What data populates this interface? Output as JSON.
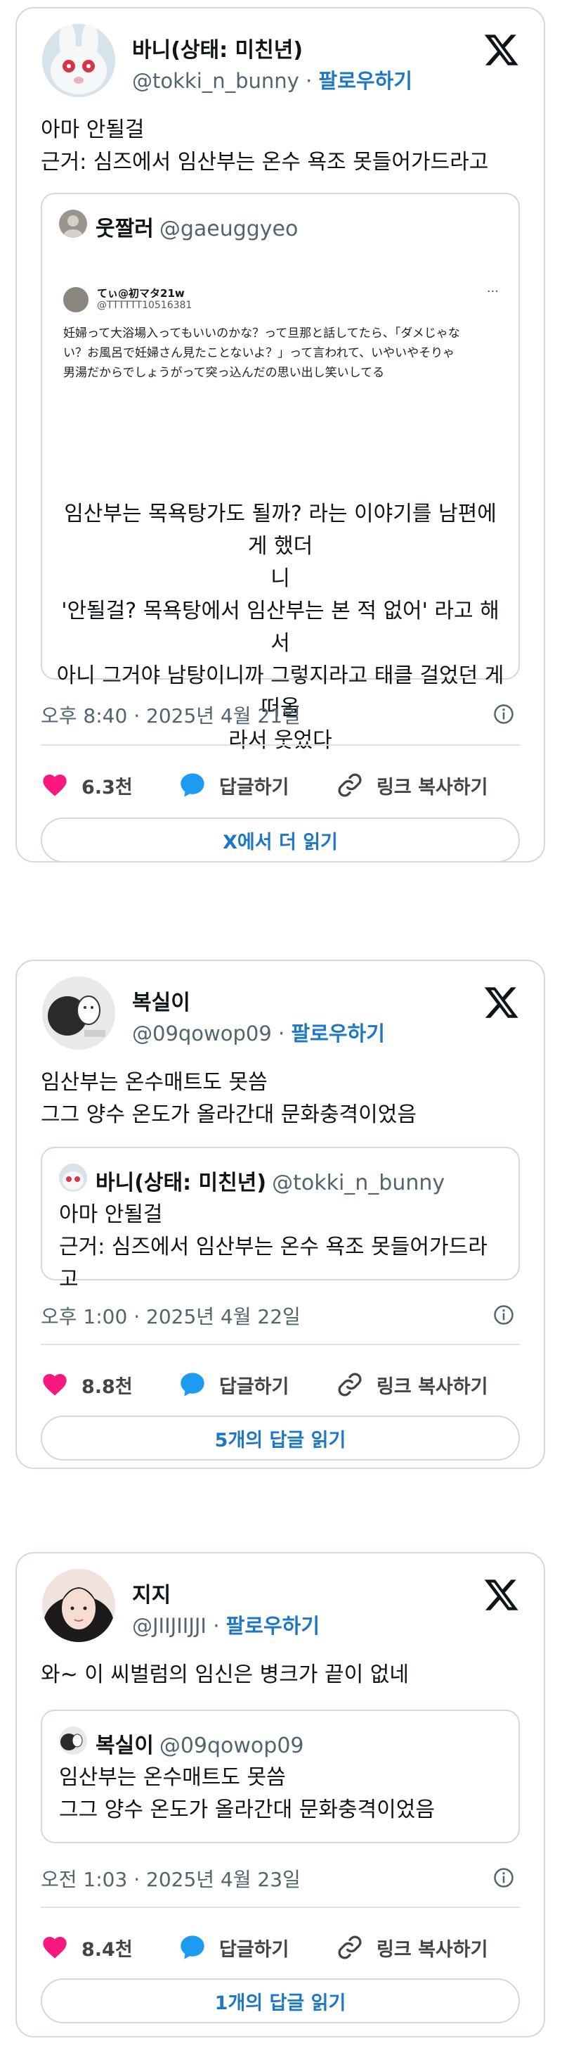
{
  "tweets": [
    {
      "name": "바니(상태: 미친년)",
      "handle": "@tokki_n_bunny",
      "follow_label": "팔로우하기",
      "separator": "·",
      "text": "아마 안될걸\n근거: 심즈에서 임산부는 온수 욕조 못들어가드라고",
      "quote": {
        "name": "웃짤러",
        "handle": "@gaeuggyeo",
        "embedded": {
          "name": "てぃ@初マタ21w",
          "id": "@TTTTTT10516381",
          "more": "···",
          "text": "妊婦って大浴場入ってもいいのかな？って旦那と話してたら、「ダメじゃな\nい？お風呂で妊婦さん見たことないよ？」って言われて、いやいやそりゃ\n男湯だからでしょうがって突っ込んだの思い出し笑いしてる"
        },
        "caption": "임산부는 목욕탕가도 될까? 라는 이야기를 남편에게 했더\n니\n'안될걸? 목욕탕에서 임산부는 본 적 없어' 라고 해서\n아니 그거야 남탕이니까 그렇지라고 태클 걸었던 게 떠올\n라서 웃었다"
      },
      "timestamp": "오후 8:40 · 2025년 4월 21일",
      "likes": "6.3천",
      "reply_label": "답글하기",
      "copy_link_label": "링크 복사하기",
      "read_more": "X에서 더 읽기"
    },
    {
      "name": "복실이",
      "handle": "@09qowop09",
      "follow_label": "팔로우하기",
      "separator": "·",
      "text": "임산부는 온수매트도 못씀\n그그 양수 온도가 올라간대 문화충격이었음",
      "quote": {
        "name": "바니(상태: 미친년)",
        "handle": "@tokki_n_bunny",
        "text": "아마 안될걸\n근거: 심즈에서 임산부는 온수 욕조 못들어가드라고"
      },
      "timestamp": "오후 1:00 · 2025년 4월 22일",
      "likes": "8.8천",
      "reply_label": "답글하기",
      "copy_link_label": "링크 복사하기",
      "read_more": "5개의 답글 읽기"
    },
    {
      "name": "지지",
      "handle": "@JIIJIIJJI",
      "follow_label": "팔로우하기",
      "separator": "·",
      "text": "와~ 이 씨벌럼의 임신은 병크가 끝이 없네",
      "quote": {
        "name": "복실이",
        "handle": "@09qowop09",
        "text": "임산부는 온수매트도 못씀\n그그 양수 온도가 올라간대 문화충격이었음"
      },
      "timestamp": "오전 1:03 · 2025년 4월 23일",
      "likes": "8.4천",
      "reply_label": "답글하기",
      "copy_link_label": "링크 복사하기",
      "read_more": "1개의 답글 읽기"
    }
  ],
  "colors": {
    "accent": "#1d77c2",
    "heart": "#f91880",
    "reply": "#1d9bf0",
    "border": "#cfd9de",
    "muted": "#536471"
  },
  "icons": [
    "x-logo-icon",
    "info-icon",
    "heart-icon",
    "reply-bubble-icon",
    "link-icon"
  ]
}
